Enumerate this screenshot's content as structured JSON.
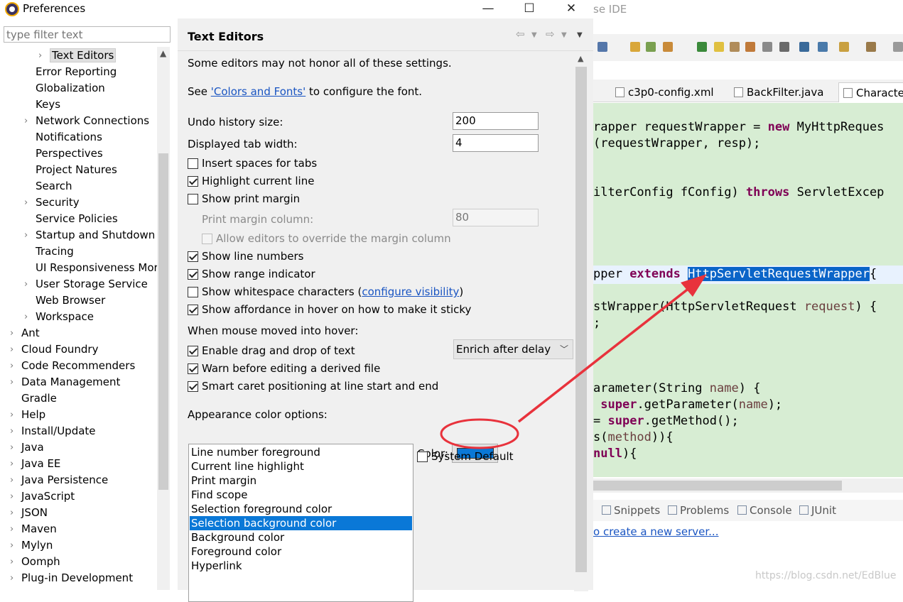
{
  "ide": {
    "title_fragment": "se IDE",
    "tabs": [
      {
        "label": "c3p0-config.xml"
      },
      {
        "label": "BackFilter.java"
      },
      {
        "label": "Character"
      }
    ],
    "code": {
      "l1_a": "rapper requestWrapper = ",
      "l1_kw": "new",
      "l1_b": " MyHttpReques",
      "l2": "(requestWrapper, resp);",
      "l3_a": "ilterConfig fConfig) ",
      "l3_kw": "throws",
      "l3_b": " ServletExcep",
      "l4_a": "pper ",
      "l4_kw": "extends",
      "l4_sel": "HttpServletRequestWrapper",
      "l4_b": "{",
      "l5_a": "stWrapper(HttpServletRequest ",
      "l5_pm": "request",
      "l5_b": ") {",
      "l6": ";",
      "l7_a": "arameter(String ",
      "l7_pm": "name",
      "l7_b": ") {",
      "l8_kw": "super",
      "l8_a": ".getParameter(",
      "l8_pm": "name",
      "l8_b": ");",
      "l9_a": "= ",
      "l9_kw": "super",
      "l9_b": ".getMethod();",
      "l10_a": "s(",
      "l10_pm": "method",
      "l10_b": ")){",
      "l11_kw": "null",
      "l11_b": "){"
    },
    "bottom_tabs": [
      {
        "label": "Snippets"
      },
      {
        "label": "Problems"
      },
      {
        "label": "Console"
      },
      {
        "label": "JUnit"
      }
    ],
    "server_link": "o create a new server...",
    "watermark": "https://blog.csdn.net/EdBlue"
  },
  "dialog": {
    "title": "Preferences",
    "window_buttons": {
      "minimize": "—",
      "maximize": "☐",
      "close": "✕"
    },
    "filter_placeholder": "type filter text",
    "tree": [
      {
        "label": "Text Editors",
        "level": 2,
        "twisty": "›",
        "selected": true
      },
      {
        "label": "Error Reporting",
        "level": 1,
        "twisty": ""
      },
      {
        "label": "Globalization",
        "level": 1,
        "twisty": ""
      },
      {
        "label": "Keys",
        "level": 1,
        "twisty": ""
      },
      {
        "label": "Network Connections",
        "level": 1,
        "twisty": "›"
      },
      {
        "label": "Notifications",
        "level": 1,
        "twisty": ""
      },
      {
        "label": "Perspectives",
        "level": 1,
        "twisty": ""
      },
      {
        "label": "Project Natures",
        "level": 1,
        "twisty": ""
      },
      {
        "label": "Search",
        "level": 1,
        "twisty": ""
      },
      {
        "label": "Security",
        "level": 1,
        "twisty": "›"
      },
      {
        "label": "Service Policies",
        "level": 1,
        "twisty": ""
      },
      {
        "label": "Startup and Shutdown",
        "level": 1,
        "twisty": "›"
      },
      {
        "label": "Tracing",
        "level": 1,
        "twisty": ""
      },
      {
        "label": "UI Responsiveness Mor",
        "level": 1,
        "twisty": ""
      },
      {
        "label": "User Storage Service",
        "level": 1,
        "twisty": "›"
      },
      {
        "label": "Web Browser",
        "level": 1,
        "twisty": ""
      },
      {
        "label": "Workspace",
        "level": 1,
        "twisty": "›"
      },
      {
        "label": "Ant",
        "level": 0,
        "twisty": "›"
      },
      {
        "label": "Cloud Foundry",
        "level": 0,
        "twisty": "›"
      },
      {
        "label": "Code Recommenders",
        "level": 0,
        "twisty": "›"
      },
      {
        "label": "Data Management",
        "level": 0,
        "twisty": "›"
      },
      {
        "label": "Gradle",
        "level": 0,
        "twisty": ""
      },
      {
        "label": "Help",
        "level": 0,
        "twisty": "›"
      },
      {
        "label": "Install/Update",
        "level": 0,
        "twisty": "›"
      },
      {
        "label": "Java",
        "level": 0,
        "twisty": "›"
      },
      {
        "label": "Java EE",
        "level": 0,
        "twisty": "›"
      },
      {
        "label": "Java Persistence",
        "level": 0,
        "twisty": "›"
      },
      {
        "label": "JavaScript",
        "level": 0,
        "twisty": "›"
      },
      {
        "label": "JSON",
        "level": 0,
        "twisty": "›"
      },
      {
        "label": "Maven",
        "level": 0,
        "twisty": "›"
      },
      {
        "label": "Mylyn",
        "level": 0,
        "twisty": "›"
      },
      {
        "label": "Oomph",
        "level": 0,
        "twisty": "›"
      },
      {
        "label": "Plug-in Development",
        "level": 0,
        "twisty": "›"
      }
    ],
    "page": {
      "title": "Text Editors",
      "intro": "Some editors may not honor all of these settings.",
      "see_prefix": "See ",
      "see_link": "'Colors and Fonts'",
      "see_suffix": " to configure the font.",
      "undo_label": "Undo history size:",
      "undo_value": "200",
      "tab_width_label": "Displayed tab width:",
      "tab_width_value": "4",
      "insert_spaces": {
        "label": "Insert spaces for tabs",
        "checked": false
      },
      "highlight_line": {
        "label": "Highlight current line",
        "checked": true
      },
      "show_print_margin": {
        "label": "Show print margin",
        "checked": false
      },
      "print_margin_label": "Print margin column:",
      "print_margin_value": "80",
      "allow_override": {
        "label": "Allow editors to override the margin column",
        "checked": false
      },
      "line_numbers": {
        "label": "Show line numbers",
        "checked": true
      },
      "range_indicator": {
        "label": "Show range indicator",
        "checked": true
      },
      "whitespace_prefix": "Show whitespace characters (",
      "whitespace_link": "configure visibility",
      "whitespace_suffix": ")",
      "whitespace_checked": false,
      "affordance": {
        "label": "Show affordance in hover on how to make it sticky",
        "checked": true
      },
      "hover_label": "When mouse moved into hover:",
      "hover_value": "Enrich after delay",
      "drag_drop": {
        "label": "Enable drag and drop of text",
        "checked": true
      },
      "warn_derived": {
        "label": "Warn before editing a derived file",
        "checked": true
      },
      "smart_caret": {
        "label": "Smart caret positioning at line start and end",
        "checked": true
      },
      "appearance_label": "Appearance color options:",
      "color_options": [
        "Line number foreground",
        "Current line highlight",
        "Print margin",
        "Find scope",
        "Selection foreground color",
        "Selection background color",
        "Background color",
        "Foreground color",
        "Hyperlink"
      ],
      "selected_color_option": 5,
      "color_label": "Color:",
      "swatch_color": "#0a78d7",
      "system_default": {
        "label": "System Default",
        "checked": false
      }
    }
  },
  "colors": {
    "accent": "#0a78d7",
    "annotation": "#e8323c",
    "editor_bg": "#d7edd3"
  }
}
